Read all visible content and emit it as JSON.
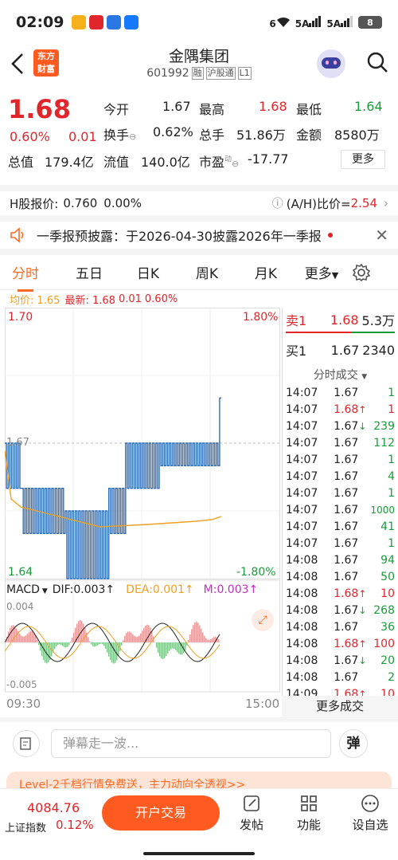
{
  "status": {
    "time": "02:09",
    "battery": "8",
    "net1": "5A",
    "net2": "5A",
    "net_signal": "6"
  },
  "header": {
    "name": "金隅集团",
    "code": "601992",
    "badges": [
      "融",
      "沪股通",
      "L1"
    ],
    "logo_line1": "东方",
    "logo_line2": "财富"
  },
  "quote": {
    "price": "1.68",
    "pct": "0.60%",
    "change": "0.01",
    "open_label": "今开",
    "open": "1.67",
    "high_label": "最高",
    "high": "1.68",
    "low_label": "最低",
    "low": "1.64",
    "turnover_label": "换手",
    "turnover": "0.62%",
    "volume_label": "总手",
    "volume": "51.86万",
    "amount_label": "金额",
    "amount": "8580万",
    "mktcap_label": "总值",
    "mktcap": "179.4亿",
    "float_label": "流值",
    "float": "140.0亿",
    "pe_label": "市盈",
    "pe_sup": "动",
    "pe": "-17.77",
    "more": "更多"
  },
  "hshare": {
    "label": "H股报价:",
    "price": "0.760",
    "pct": "0.00%",
    "ah_label": "(A/H)比价=",
    "ah": "2.54"
  },
  "notice": {
    "text": "一季报预披露：于2026-04-30披露2026年一季报"
  },
  "tabs": [
    "分时",
    "五日",
    "日K",
    "周K",
    "月K",
    "更多"
  ],
  "avgline": {
    "avg_label": "均价: 1.65",
    "latest_label": "最新: 1.68",
    "latest_chg": "0.01",
    "latest_pct": "0.60%"
  },
  "chart": {
    "y_top": "1.70",
    "y_top_pct": "1.80%",
    "y_mid": "1.67",
    "y_bot": "1.64",
    "y_bot_pct": "-1.80%",
    "macd_label": "MACD",
    "dif": "DIF:0.003↑",
    "dea": "DEA:0.001↑",
    "m": "M:0.003↑",
    "macd_top": "0.004",
    "macd_bot": "-0.005",
    "t_start": "09:30",
    "t_end": "15:00"
  },
  "orderbook": {
    "sell_label": "卖1",
    "sell_price": "1.68",
    "sell_vol": "5.3万",
    "buy_label": "买1",
    "buy_price": "1.67",
    "buy_vol": "2340",
    "ticks_title": "分时成交",
    "more": "更多成交"
  },
  "ticks": [
    {
      "t": "14:07",
      "p": "1.67",
      "a": "",
      "v": "1",
      "pc": "black",
      "vc": "green"
    },
    {
      "t": "14:07",
      "p": "1.68",
      "a": "↑",
      "v": "1",
      "pc": "red",
      "vc": "red"
    },
    {
      "t": "14:07",
      "p": "1.67",
      "a": "↓",
      "v": "239",
      "pc": "black",
      "vc": "green"
    },
    {
      "t": "14:07",
      "p": "1.67",
      "a": "",
      "v": "112",
      "pc": "black",
      "vc": "green"
    },
    {
      "t": "14:07",
      "p": "1.67",
      "a": "",
      "v": "1",
      "pc": "black",
      "vc": "green"
    },
    {
      "t": "14:07",
      "p": "1.67",
      "a": "",
      "v": "4",
      "pc": "black",
      "vc": "green"
    },
    {
      "t": "14:07",
      "p": "1.67",
      "a": "",
      "v": "1",
      "pc": "black",
      "vc": "green"
    },
    {
      "t": "14:07",
      "p": "1.67",
      "a": "",
      "v": "1000",
      "pc": "black",
      "vc": "green"
    },
    {
      "t": "14:07",
      "p": "1.67",
      "a": "",
      "v": "41",
      "pc": "black",
      "vc": "green"
    },
    {
      "t": "14:07",
      "p": "1.67",
      "a": "",
      "v": "1",
      "pc": "black",
      "vc": "green"
    },
    {
      "t": "14:08",
      "p": "1.67",
      "a": "",
      "v": "94",
      "pc": "black",
      "vc": "green"
    },
    {
      "t": "14:08",
      "p": "1.67",
      "a": "",
      "v": "50",
      "pc": "black",
      "vc": "green"
    },
    {
      "t": "14:08",
      "p": "1.68",
      "a": "↑",
      "v": "10",
      "pc": "red",
      "vc": "red"
    },
    {
      "t": "14:08",
      "p": "1.67",
      "a": "↓",
      "v": "268",
      "pc": "black",
      "vc": "green"
    },
    {
      "t": "14:08",
      "p": "1.67",
      "a": "",
      "v": "36",
      "pc": "black",
      "vc": "green"
    },
    {
      "t": "14:08",
      "p": "1.68",
      "a": "↑",
      "v": "100",
      "pc": "red",
      "vc": "red"
    },
    {
      "t": "14:08",
      "p": "1.67",
      "a": "↓",
      "v": "20",
      "pc": "black",
      "vc": "green"
    },
    {
      "t": "14:08",
      "p": "1.67",
      "a": "",
      "v": "2",
      "pc": "black",
      "vc": "green"
    },
    {
      "t": "14:09",
      "p": "1.68",
      "a": "↑",
      "v": "10",
      "pc": "red",
      "vc": "red"
    }
  ],
  "comment": {
    "placeholder": "弹幕走一波...",
    "danmu": "弹"
  },
  "banner": {
    "text": "Level-2千档行情免费送，主力动向全透视>>"
  },
  "bottom": {
    "index_value": "4084.76",
    "index_name": "上证指数",
    "index_pct": "0.12%",
    "trade": "开户交易",
    "post": "发帖",
    "func": "功能",
    "custom": "设自选"
  },
  "colors": {
    "red": "#e0262b",
    "green": "#1a9b3a",
    "orange": "#ff6a22",
    "line": "#2f6db5",
    "avgline": "#f0a020"
  }
}
